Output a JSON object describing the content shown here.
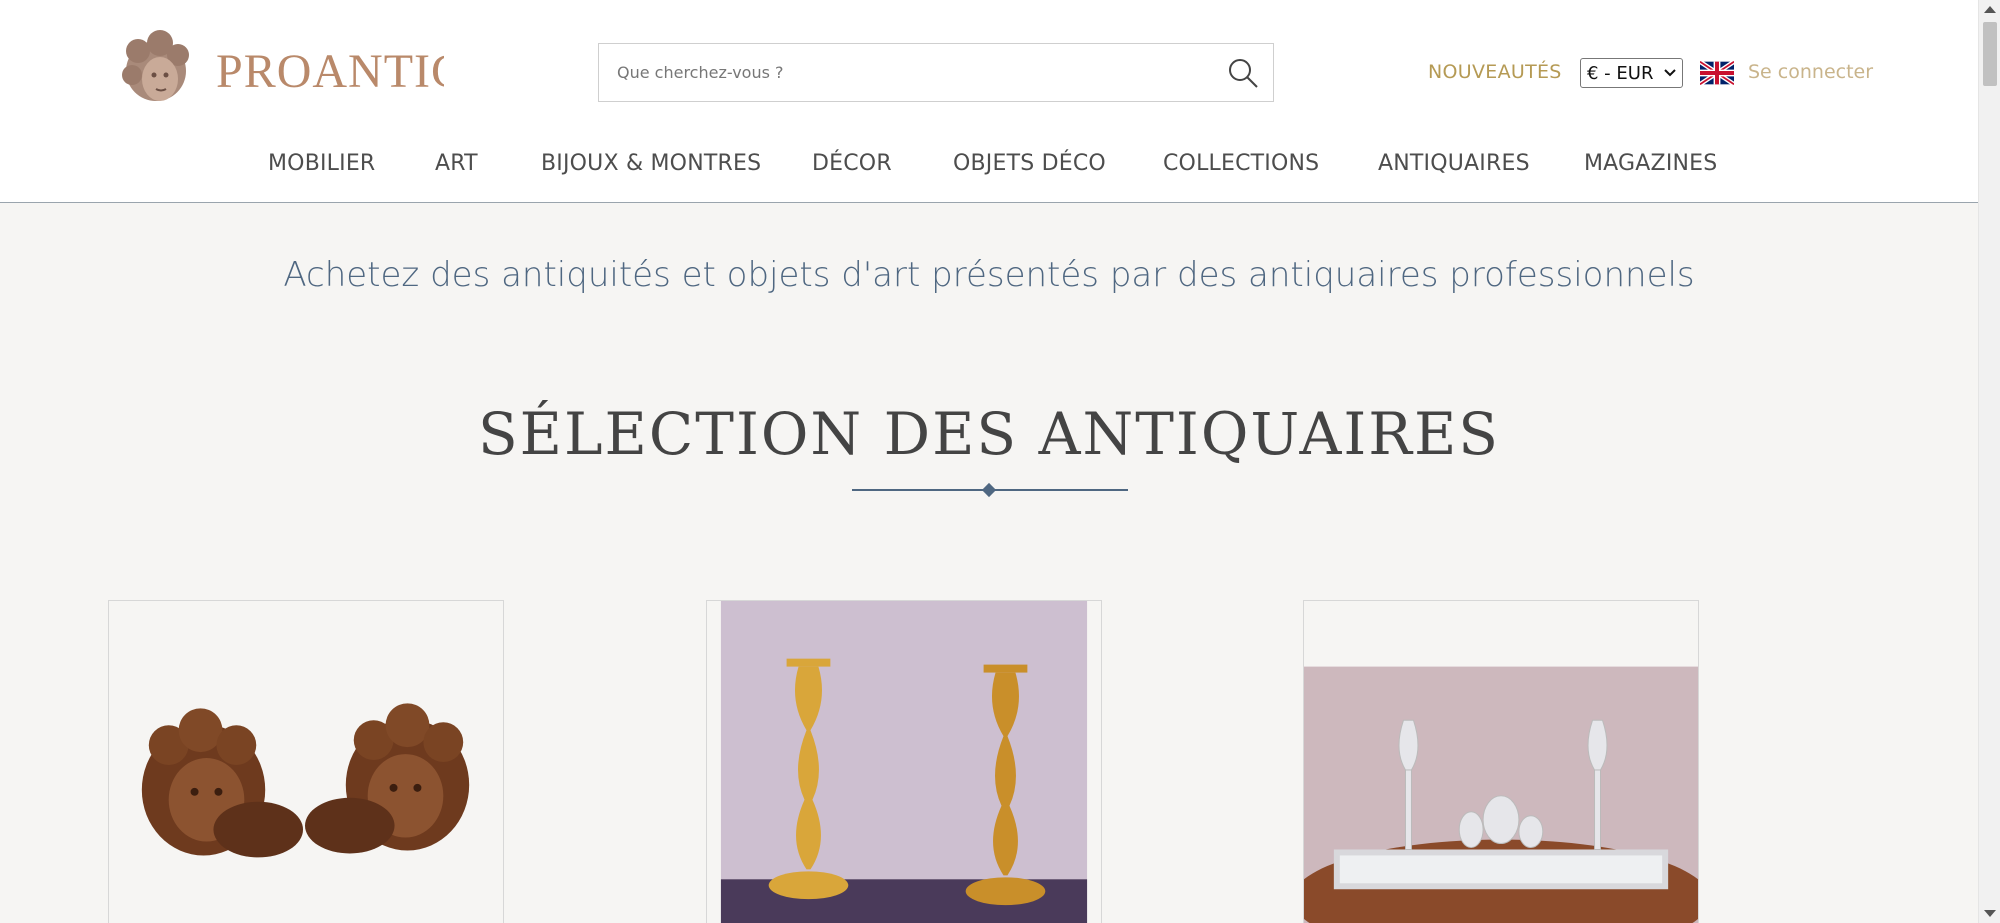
{
  "header": {
    "logo_text": "PROANTIC",
    "search": {
      "placeholder": "Que cherchez-vous ?"
    },
    "nouveautes_label": "NOUVEAUTÉS",
    "currency_value": "€ - EUR",
    "login_label": "Se connecter"
  },
  "nav": {
    "items": [
      {
        "label": "MOBILIER"
      },
      {
        "label": "ART"
      },
      {
        "label": "BIJOUX & MONTRES"
      },
      {
        "label": "DÉCOR"
      },
      {
        "label": "OBJETS DÉCO"
      },
      {
        "label": "COLLECTIONS"
      },
      {
        "label": "ANTIQUAIRES"
      },
      {
        "label": "MAGAZINES"
      }
    ]
  },
  "main": {
    "tagline": "Achetez des antiquités et objets d'art présentés par des antiquaires professionnels",
    "section_title": "SÉLECTION DES ANTIQUAIRES",
    "cards": [
      {
        "image": "carved-wood-cherub-heads"
      },
      {
        "image": "gilt-bronze-candlesticks"
      },
      {
        "image": "silver-mirror-plateau-with-glass"
      }
    ]
  },
  "colors": {
    "accent_gold": "#b59a54",
    "tagline_blue": "#4f6781",
    "logo_color": "#b9896a",
    "page_bg": "#f6f5f3"
  }
}
